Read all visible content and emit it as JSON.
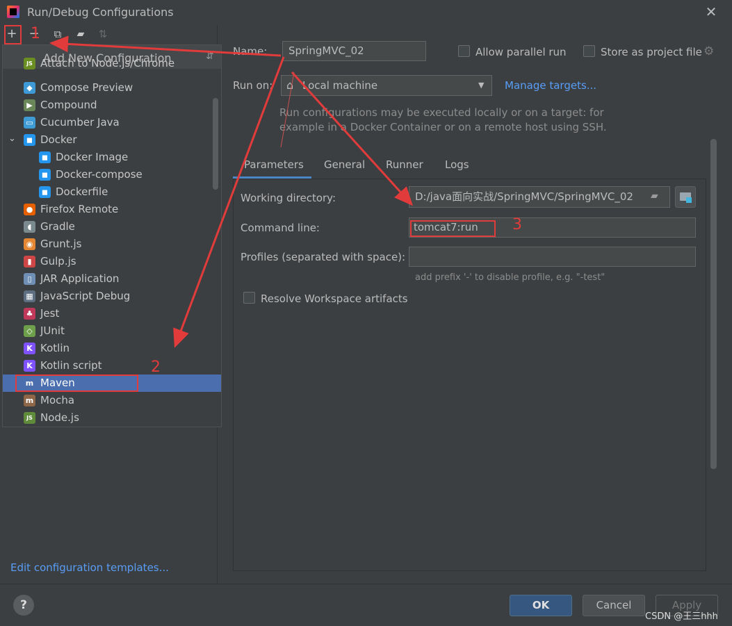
{
  "window": {
    "title": "Run/Debug Configurations",
    "close_glyph": "✕"
  },
  "toolbar": {
    "add_glyph": "+",
    "remove_glyph": "−",
    "copy_glyph": "⧉",
    "folder_glyph": "▰",
    "sort_glyph": "⇅"
  },
  "popup": {
    "title": "Add New Configuration",
    "sort_glyph": "⇵",
    "items": [
      {
        "label": "Attach to Node.js/Chrome",
        "icon": "nodejs-icon",
        "glyph": "JS",
        "color": "#6b8e23"
      },
      {
        "label": "Compose Preview",
        "icon": "compose-icon",
        "glyph": "◆",
        "color": "#3d9ad6"
      },
      {
        "label": "Compound",
        "icon": "compound-icon",
        "glyph": "▶",
        "color": "#6a8759"
      },
      {
        "label": "Cucumber Java",
        "icon": "cucumber-icon",
        "glyph": "▭",
        "color": "#3f9bd3"
      },
      {
        "label": "Docker",
        "icon": "docker-icon",
        "glyph": "◼",
        "color": "#2496ed",
        "expander": "⌄"
      },
      {
        "label": "Docker Image",
        "icon": "docker-icon",
        "glyph": "◼",
        "color": "#2496ed"
      },
      {
        "label": "Docker-compose",
        "icon": "docker-icon",
        "glyph": "◼",
        "color": "#2496ed"
      },
      {
        "label": "Dockerfile",
        "icon": "docker-icon",
        "glyph": "◼",
        "color": "#2496ed"
      },
      {
        "label": "Firefox Remote",
        "icon": "firefox-icon",
        "glyph": "●",
        "color": "#e66000"
      },
      {
        "label": "Gradle",
        "icon": "gradle-icon",
        "glyph": "◖",
        "color": "#7a8a8f"
      },
      {
        "label": "Grunt.js",
        "icon": "grunt-icon",
        "glyph": "◉",
        "color": "#e48632"
      },
      {
        "label": "Gulp.js",
        "icon": "gulp-icon",
        "glyph": "▮",
        "color": "#cf4646"
      },
      {
        "label": "JAR Application",
        "icon": "jar-icon",
        "glyph": "▯",
        "color": "#6f8fb5"
      },
      {
        "label": "JavaScript Debug",
        "icon": "js-debug-icon",
        "glyph": "▦",
        "color": "#5c6e80"
      },
      {
        "label": "Jest",
        "icon": "jest-icon",
        "glyph": "♣",
        "color": "#c0385a"
      },
      {
        "label": "JUnit",
        "icon": "junit-icon",
        "glyph": "◇",
        "color": "#6ea04b"
      },
      {
        "label": "Kotlin",
        "icon": "kotlin-icon",
        "glyph": "K",
        "color": "#7f52ff"
      },
      {
        "label": "Kotlin script",
        "icon": "kotlin-icon",
        "glyph": "K",
        "color": "#7f52ff"
      },
      {
        "label": "Maven",
        "icon": "maven-icon",
        "glyph": "m",
        "color": "#4b6eaf"
      },
      {
        "label": "Mocha",
        "icon": "mocha-icon",
        "glyph": "m",
        "color": "#8d6748"
      },
      {
        "label": "Node.js",
        "icon": "nodejs-icon",
        "glyph": "JS",
        "color": "#5f8b3b"
      }
    ]
  },
  "edit_templates_label": "Edit configuration templates...",
  "form": {
    "name_label": "Name:",
    "name_value": "SpringMVC_02",
    "allow_parallel_label": "Allow parallel run",
    "store_project_label": "Store as project file",
    "run_on_label": "Run on:",
    "run_on_value": "Local machine",
    "run_on_arrow": "▼",
    "manage_targets": "Manage targets...",
    "hint_line1": "Run configurations may be executed locally or on a target: for",
    "hint_line2": "example in a Docker Container or on a remote host using SSH.",
    "tabs": [
      "Parameters",
      "General",
      "Runner",
      "Logs"
    ],
    "working_dir_label": "Working directory:",
    "working_dir_value": "D:/java面向实战/SpringMVC/SpringMVC_02",
    "command_line_label": "Command line:",
    "command_line_value": "tomcat7:run",
    "profiles_label": "Profiles (separated with space):",
    "profiles_value": "",
    "profiles_hint": "add prefix '-' to disable profile, e.g. \"-test\"",
    "resolve_workspace_label": "Resolve Workspace artifacts"
  },
  "footer": {
    "help": "?",
    "ok": "OK",
    "cancel": "Cancel",
    "apply": "Apply",
    "watermark": "CSDN @王三hhh"
  },
  "annotations": {
    "n1": "1",
    "n2": "2",
    "n3": "3",
    "color": "#e23b3b"
  }
}
